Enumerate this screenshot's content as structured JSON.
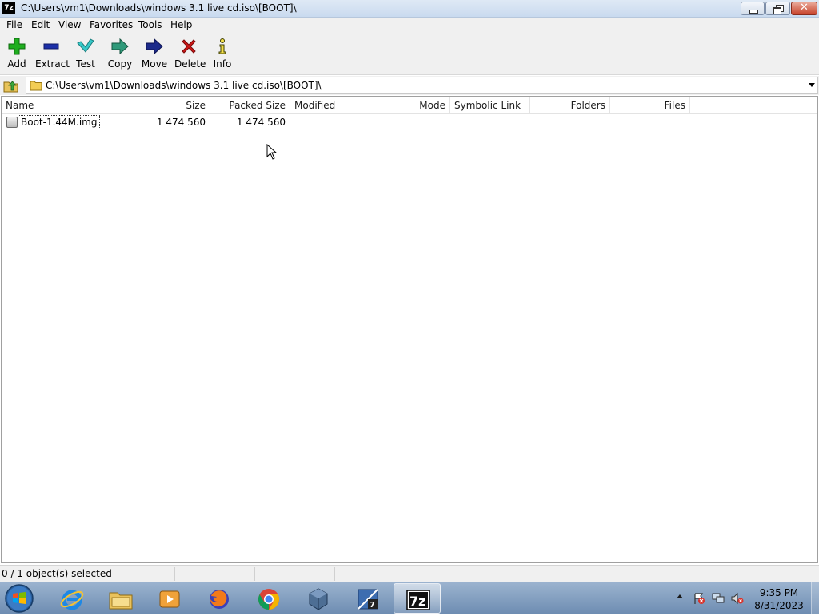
{
  "window": {
    "icon_label": "7z",
    "title": "C:\\Users\\vm1\\Downloads\\windows 3.1 live cd.iso\\[BOOT]\\"
  },
  "menu": [
    "File",
    "Edit",
    "View",
    "Favorites",
    "Tools",
    "Help"
  ],
  "toolbar": [
    {
      "label": "Add",
      "icon": "plus-icon",
      "color": "#1fae1f"
    },
    {
      "label": "Extract",
      "icon": "minus-icon",
      "color": "#1c2fa8"
    },
    {
      "label": "Test",
      "icon": "check-icon",
      "color": "#2bbfbf"
    },
    {
      "label": "Copy",
      "icon": "copy-arrow-icon",
      "color": "#2f9a7a"
    },
    {
      "label": "Move",
      "icon": "move-arrow-icon",
      "color": "#1c2a8a"
    },
    {
      "label": "Delete",
      "icon": "delete-x-icon",
      "color": "#d01818"
    },
    {
      "label": "Info",
      "icon": "info-icon",
      "color": "#4a4a00"
    }
  ],
  "address": {
    "path": "C:\\Users\\vm1\\Downloads\\windows 3.1 live cd.iso\\[BOOT]\\"
  },
  "columns": [
    "Name",
    "Size",
    "Packed Size",
    "Modified",
    "Mode",
    "Symbolic Link",
    "Folders",
    "Files"
  ],
  "rows": [
    {
      "name": "Boot-1.44M.img",
      "size": "1 474 560",
      "packed_size": "1 474 560",
      "modified": "",
      "mode": "",
      "symbolic_link": "",
      "folders": "",
      "files": ""
    }
  ],
  "status": {
    "selection": "0 / 1 object(s) selected"
  },
  "taskbar": {
    "items": [
      "start-orb",
      "internet-explorer-icon",
      "file-explorer-icon",
      "media-player-icon",
      "firefox-icon",
      "chrome-icon",
      "virtualbox-icon",
      "7zip-installer-icon",
      "7zip-filemanager-icon"
    ],
    "active_item": "7zip-filemanager-icon",
    "clock_time": "9:35 PM",
    "clock_date": "8/31/2023"
  }
}
